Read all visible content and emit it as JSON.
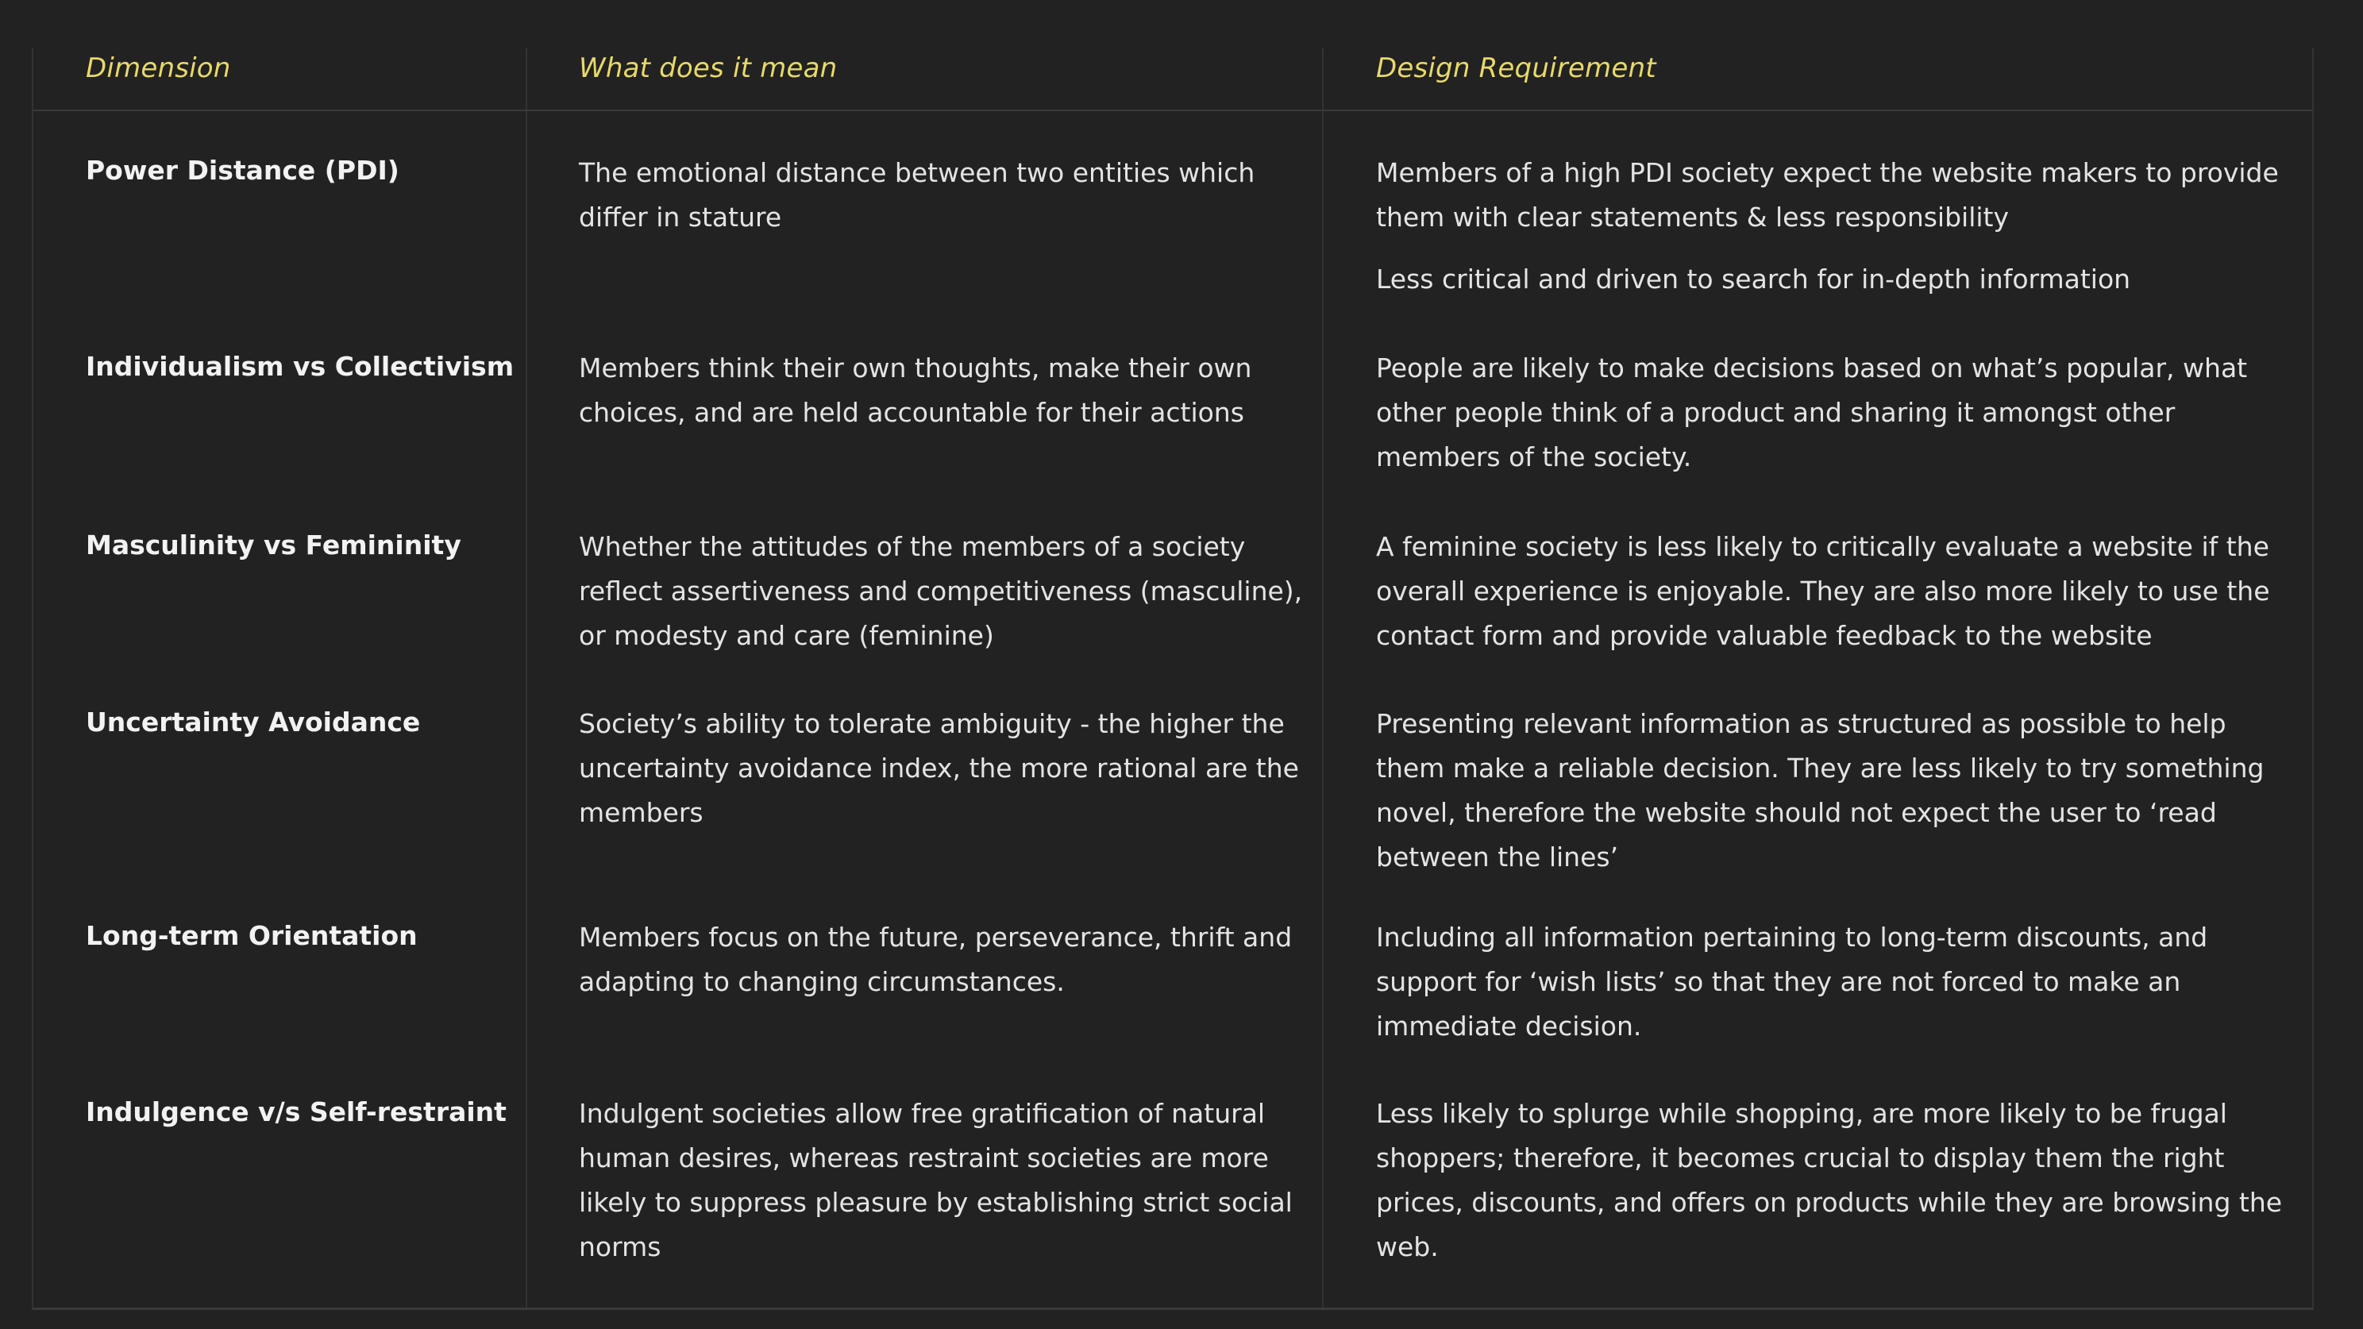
{
  "header": {
    "dimension": "Dimension",
    "meaning": "What does it mean",
    "requirement": "Design Requirement"
  },
  "rows": [
    {
      "dimension": "Power Distance (PDI)",
      "meaning": "The emotional distance between two entities which differ in stature",
      "requirement": "Members of a high PDI society expect the website makers to provide them with clear statements & less responsibility",
      "requirement_extra": "Less critical and driven to search for in-depth information"
    },
    {
      "dimension": "Individualism vs Collectivism",
      "meaning": "Members think their own thoughts, make their own choices, and are held accountable for their actions",
      "requirement": "People are likely to make decisions based on what’s popular, what other people think of a product and sharing it amongst other members of the society."
    },
    {
      "dimension": "Masculinity vs Femininity",
      "meaning": "Whether the attitudes of the members of a society reflect assertiveness and competitiveness (masculine), or modesty and care (feminine)",
      "requirement": "A feminine society is less likely to critically evaluate a website if the overall experience is enjoyable. They are also more likely to use the contact form and provide valuable feedback to the website"
    },
    {
      "dimension": "Uncertainty Avoidance",
      "meaning": "Society’s ability to tolerate ambiguity - the higher the uncertainty avoidance index, the more rational are the members",
      "requirement": "Presenting relevant information as structured as possible to help them make a reliable decision. They are less likely to try something novel, therefore the website should not expect the user to ‘read between the lines’"
    },
    {
      "dimension": "Long-term Orientation",
      "meaning": "Members focus on the future, perseverance, thrift and adapting to changing circumstances.",
      "requirement": "Including all information pertaining to long-term discounts, and support for ‘wish lists’ so that they are not forced to make an immediate decision."
    },
    {
      "dimension": "Indulgence v/s Self-restraint",
      "meaning": "Indulgent societies allow free gratification of natural human desires, whereas restraint societies are more likely to suppress pleasure by establishing strict social norms",
      "requirement": "Less likely to splurge while shopping,  are more likely to be frugal shoppers; therefore, it becomes crucial to display them the right prices, discounts, and offers on products while they are browsing the web."
    }
  ]
}
